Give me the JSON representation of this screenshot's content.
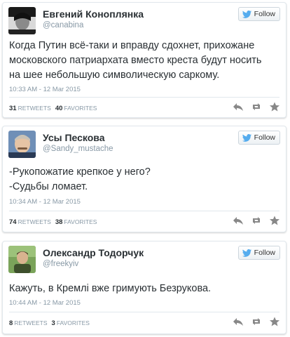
{
  "follow_label": "Follow",
  "retweets_label": "RETWEETS",
  "favorites_label": "FAVORITES",
  "tweets": [
    {
      "name": "Евгений Коноплянка",
      "handle": "@canabina",
      "text": "Когда Путин всё-таки и вправду сдохнет, прихожане\nмосковского патриархата вместо креста будут носить\nна шее небольшую символическую саркому.",
      "time": "10:33 AM - 12 Mar 2015",
      "retweets": "31",
      "favorites": "40"
    },
    {
      "name": "Усы Пескова",
      "handle": "@Sandy_mustache",
      "text": "-Рукопожатие крепкое у него?\n-Судьбы ломает.",
      "time": "10:34 AM - 12 Mar 2015",
      "retweets": "74",
      "favorites": "38"
    },
    {
      "name": "Олександр Тодорчук",
      "handle": "@freekyiv",
      "text": "Кажуть, в Кремлі вже гримують Безрукова.",
      "time": "10:44 AM - 12 Mar 2015",
      "retweets": "8",
      "favorites": "3"
    }
  ],
  "colors": {
    "accent": "#55acee",
    "text": "#292f33",
    "muted": "#8899a6",
    "border": "#e1e8ed"
  }
}
